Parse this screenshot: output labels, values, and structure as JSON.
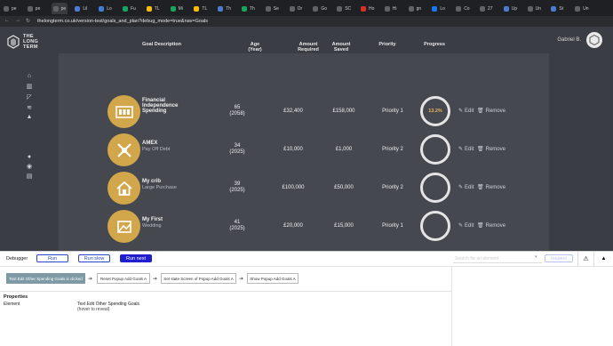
{
  "browser": {
    "tabs": [
      "pe",
      "pe",
      "pe",
      "Lil",
      "Lo",
      "Fu",
      "TL",
      "Mi",
      "TL",
      "Th",
      "Th",
      "Se",
      "Or",
      "Go",
      "SC",
      "Ho",
      "Hi",
      "gn",
      "Lo",
      "Co",
      "27",
      "Up",
      "Un",
      "St",
      "Un"
    ],
    "url": "thelongterm.co.uk/version-test/goals_and_plan?debug_mode=true&nav=Goals"
  },
  "app": {
    "logo_lines": [
      "THE",
      "LONG",
      "TERM"
    ],
    "user_name": "Gabriel B.",
    "table_headers": {
      "goal": "Goal Description",
      "age": "Age\n(Year)",
      "required": "Amount\nRequired",
      "saved": "Amount\nSaved",
      "priority": "Priority",
      "progress": "Progress"
    },
    "edit_label": "Edit",
    "remove_label": "Remove",
    "goals": [
      {
        "name": "Financial Independence Spending",
        "sub": "",
        "age": "65",
        "year": "(2058)",
        "required": "£32,400",
        "saved": "£158,000",
        "priority": "Priority 1",
        "progress": "13.2%",
        "icon": "calculator-icon"
      },
      {
        "name": "AMEX",
        "sub": "Pay Off Debt",
        "age": "34",
        "year": "(2025)",
        "required": "£10,000",
        "saved": "£1,000",
        "priority": "Priority 2",
        "progress": "",
        "icon": "no-debt-icon"
      },
      {
        "name": "My crib",
        "sub": "Large Purchase",
        "age": "39",
        "year": "(2025)",
        "required": "£100,000",
        "saved": "£50,000",
        "priority": "Priority 2",
        "progress": "",
        "icon": "house-icon"
      },
      {
        "name": "My First",
        "sub": "Wedding",
        "age": "41",
        "year": "(2025)",
        "required": "£20,000",
        "saved": "£15,000",
        "priority": "Priority 1",
        "progress": "",
        "icon": "wedding-icon"
      }
    ]
  },
  "debugger": {
    "label": "Debugger",
    "run": "Run",
    "run_slow": "Run slow",
    "run_next": "Run next",
    "inspect": "Inspect",
    "search_placeholder": "Search for an element",
    "steps": [
      "Text Edit Other Spending Goals is clicked",
      "Reset Popup Add Goals A",
      "Set state Screen of Popup Add Goals A",
      "Show Popup Add Goals A"
    ],
    "properties_title": "Properties",
    "element_label": "Element",
    "element_value": "Text Edit Other Spending Goals",
    "element_hint": "(hover to reveal)"
  },
  "colors": {
    "gold": "#d2a64a",
    "panel": "#45484f",
    "blue": "#2e47c9",
    "progress_text": "#e7b65c"
  }
}
